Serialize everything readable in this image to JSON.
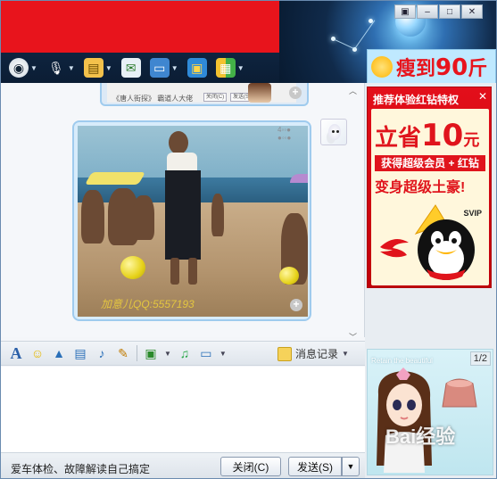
{
  "window_controls": {
    "skin": "▣",
    "minimize": "–",
    "maximize": "□",
    "close": "✕"
  },
  "toolbar": {
    "items": [
      {
        "icon": "webcam-icon",
        "glyph": "◉"
      },
      {
        "icon": "microphone-icon",
        "glyph": "🎙"
      },
      {
        "icon": "file-transfer-icon",
        "glyph": "▤"
      },
      {
        "icon": "sms-icon",
        "glyph": "✉"
      },
      {
        "icon": "remote-desktop-icon",
        "glyph": "▭"
      },
      {
        "icon": "screen-share-icon",
        "glyph": "▣"
      },
      {
        "icon": "apps-icon",
        "glyph": "▦"
      }
    ]
  },
  "ad_weight": {
    "text": "瘦到",
    "number": "90",
    "unit": "斤"
  },
  "chat": {
    "prev_caption": "《唐人街探》 霸道人大佬",
    "prev_close": "关闭(C)",
    "prev_send": "发送(S)",
    "image_timestamp_1": "4◦◦●",
    "image_timestamp_2": "●◦◦●",
    "watermark": "加意儿QQ:5557193"
  },
  "input_toolbar": {
    "history_label": "消息记录"
  },
  "bottom": {
    "tip": "爱车体检、故障解读自己搞定",
    "close_button": "关闭(C)",
    "send_button": "发送(S)"
  },
  "ad_red": {
    "title": "推荐体验红钻特权",
    "close": "✕",
    "save_prefix": "立省",
    "save_amount": "10",
    "save_unit": "元",
    "get_text": "获得超级会员 + 红钻",
    "rich_text": "变身超级土豪!",
    "svip": "SVIP"
  },
  "ad_girl": {
    "text": "Retain the beautiful",
    "page": "1/2",
    "watermark": "Bai经验"
  }
}
